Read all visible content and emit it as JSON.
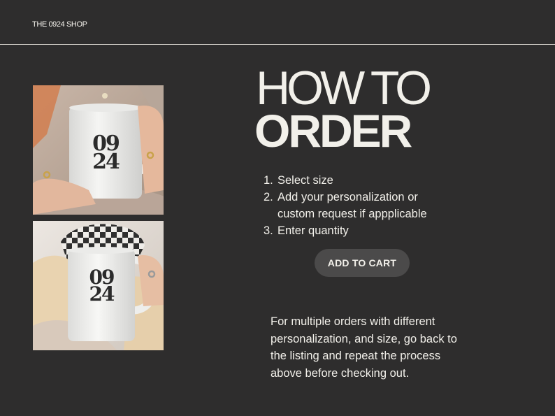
{
  "header": {
    "shop_name": "THE 0924 SHOP"
  },
  "photos": [
    {
      "icon": "mug-photo",
      "mug_text_top": "09",
      "mug_text_bottom": "24"
    },
    {
      "icon": "mug-photo",
      "mug_text_top": "09",
      "mug_text_bottom": "24"
    }
  ],
  "title": {
    "line1": "HOW TO",
    "line2": "ORDER"
  },
  "steps": [
    {
      "number": "1.",
      "text": "Select size"
    },
    {
      "number": "2.",
      "text": "Add your personalization or"
    },
    {
      "number": "",
      "text": "custom request if appplicable"
    },
    {
      "number": "3.",
      "text": "Enter quantity"
    }
  ],
  "cart_button": {
    "label": "ADD TO CART"
  },
  "note": "For multiple orders with different personalization, and size, go back to the listing and repeat the process above before checking out.",
  "colors": {
    "background": "#2e2d2d",
    "text": "#f2f0ea",
    "button": "#4b4a4a"
  }
}
